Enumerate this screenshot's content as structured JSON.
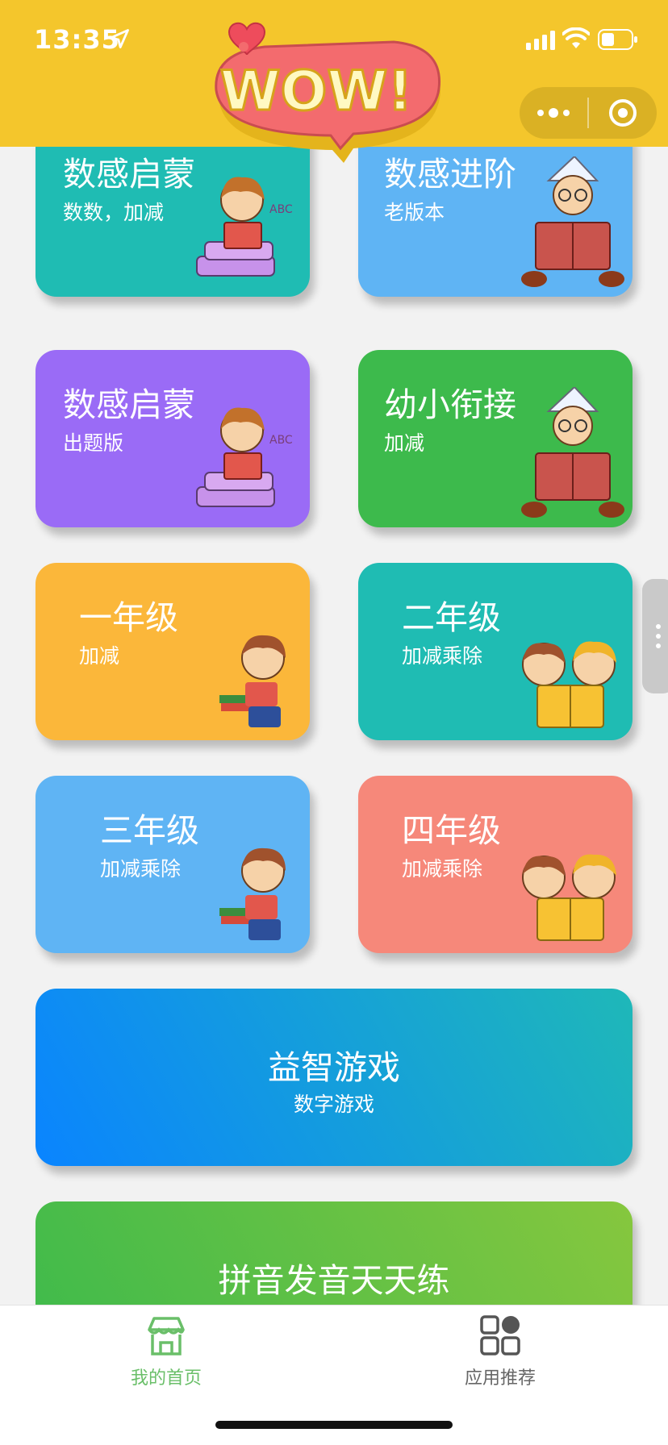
{
  "status_bar": {
    "time": "13:35",
    "icons": [
      "location-arrow-icon",
      "cellular-signal-icon",
      "wifi-icon",
      "battery-icon"
    ]
  },
  "header": {
    "logo_text": "WOW!",
    "capsule_icons": [
      "more-dots-icon",
      "close-target-icon"
    ],
    "background_color": "#f4c62c"
  },
  "cards": [
    {
      "title": "数感启蒙",
      "subtitle": "数数，加减",
      "color": "#1fbcb3",
      "illustration": "girl-reading-icon"
    },
    {
      "title": "数感进阶",
      "subtitle": "老版本",
      "color": "#5fb4f4",
      "illustration": "boy-reading-book-icon"
    },
    {
      "title": "数感启蒙",
      "subtitle": "出题版",
      "color": "#9a6bf6",
      "illustration": "girl-reading-icon"
    },
    {
      "title": "幼小衔接",
      "subtitle": "加减",
      "color": "#3dba4c",
      "illustration": "boy-reading-book-icon"
    },
    {
      "title": "一年级",
      "subtitle": "加减",
      "color": "#fbb73a",
      "illustration": "boy-with-books-icon"
    },
    {
      "title": "二年级",
      "subtitle": "加减乘除",
      "color": "#1fbcb3",
      "illustration": "two-kids-reading-icon"
    },
    {
      "title": "三年级",
      "subtitle": "加减乘除",
      "color": "#5fb4f4",
      "illustration": "boy-with-books-icon"
    },
    {
      "title": "四年级",
      "subtitle": "加减乘除",
      "color": "#f6887a",
      "illustration": "two-kids-reading-icon"
    }
  ],
  "wide_cards": [
    {
      "title": "益智游戏",
      "subtitle": "数字游戏",
      "gradient": [
        "#0a84ff",
        "#1fb8b8"
      ]
    },
    {
      "title": "拼音发音天天练",
      "subtitle": "",
      "gradient": [
        "#3dba4c",
        "#86c73e"
      ]
    }
  ],
  "tabbar": {
    "tabs": [
      {
        "label": "我的首页",
        "icon": "storefront-home-icon",
        "active": true,
        "color": "#6abf69"
      },
      {
        "label": "应用推荐",
        "icon": "apps-grid-icon",
        "active": false,
        "color": "#666666"
      }
    ]
  }
}
